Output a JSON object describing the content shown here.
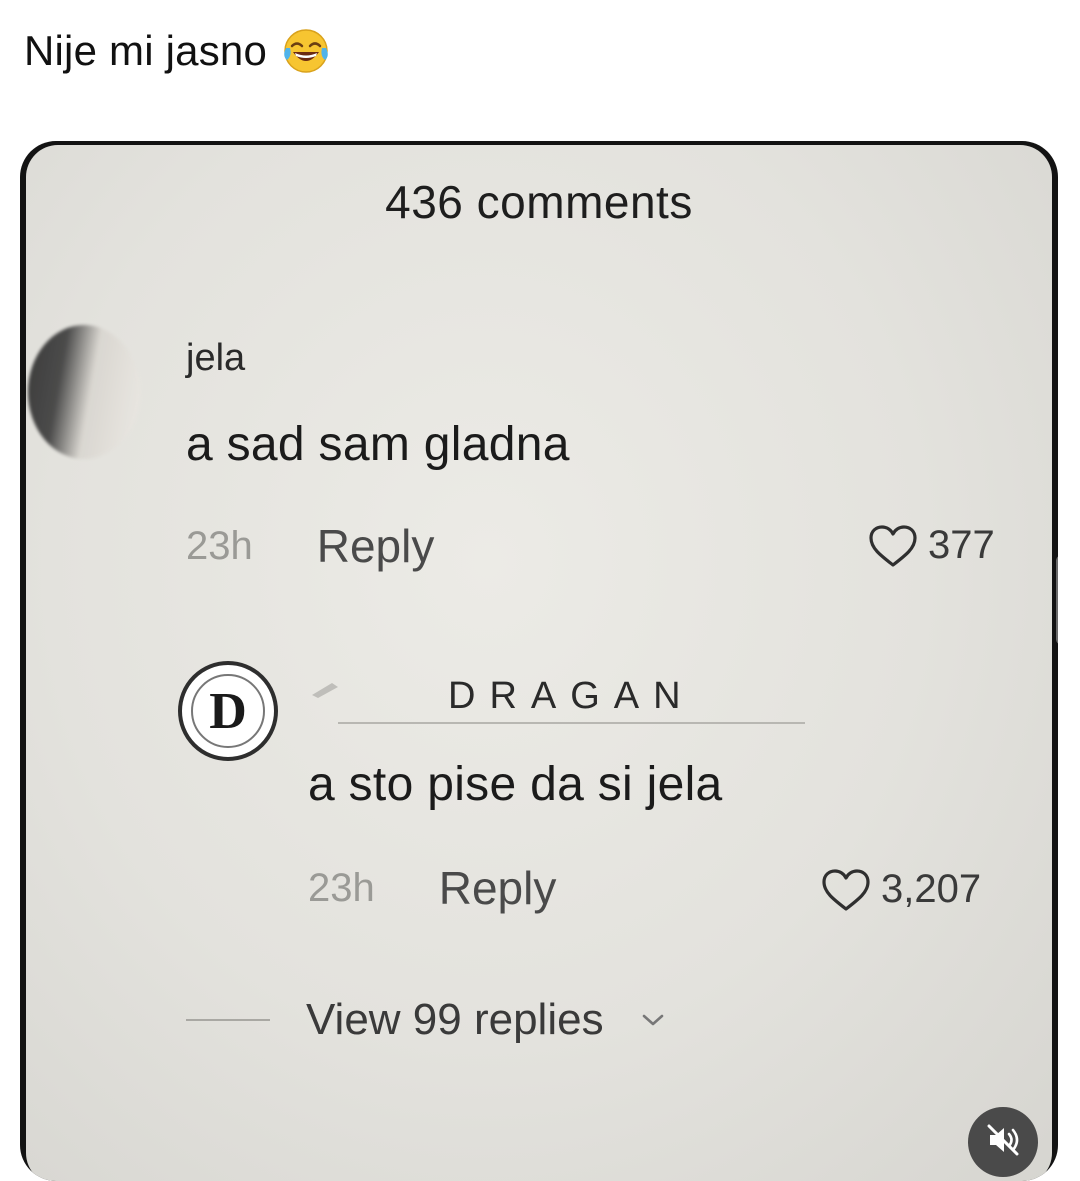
{
  "post": {
    "caption": "Nije mi jasno",
    "emoji": "laughing-tears-emoji"
  },
  "screenshot": {
    "comments_count": "436 comments",
    "comments": [
      {
        "username": "jela",
        "text": "a sad sam gladna",
        "time": "23h",
        "reply_label": "Reply",
        "likes": "377"
      },
      {
        "username": "DRAGAN",
        "avatar_letter": "D",
        "text": "a sto pise da si jela",
        "time": "23h",
        "reply_label": "Reply",
        "likes": "3,207"
      }
    ],
    "view_replies": "View 99 replies"
  },
  "icons": {
    "heart": "heart-outline-icon",
    "chevron": "chevron-down-icon",
    "mute": "speaker-muted-icon"
  }
}
